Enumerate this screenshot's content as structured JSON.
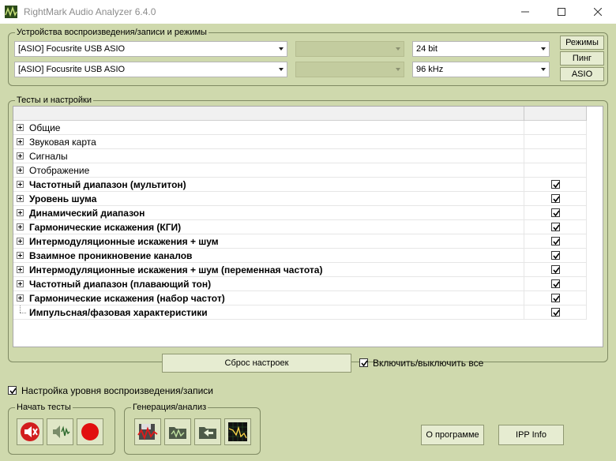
{
  "window": {
    "title": "RightMark Audio Analyzer 6.4.0"
  },
  "devices": {
    "label": "Устройства воспроизведения/записи и режимы",
    "playback_device": "[ASIO] Focusrite USB ASIO",
    "record_device": "[ASIO] Focusrite USB ASIO",
    "bit_depth": "24 bit",
    "sample_rate": "96 kHz",
    "modes_button": "Режимы",
    "ping_button": "Пинг",
    "asio_button": "ASIO"
  },
  "tests": {
    "label": "Тесты и настройки",
    "rows": [
      {
        "label": "Общие",
        "bold": false,
        "expandable": true,
        "checked": false,
        "has_checkbox": false
      },
      {
        "label": "Звуковая карта",
        "bold": false,
        "expandable": true,
        "checked": false,
        "has_checkbox": false
      },
      {
        "label": "Сигналы",
        "bold": false,
        "expandable": true,
        "checked": false,
        "has_checkbox": false
      },
      {
        "label": "Отображение",
        "bold": false,
        "expandable": true,
        "checked": false,
        "has_checkbox": false
      },
      {
        "label": "Частотный диапазон (мультитон)",
        "bold": true,
        "expandable": true,
        "checked": true,
        "has_checkbox": true
      },
      {
        "label": "Уровень шума",
        "bold": true,
        "expandable": true,
        "checked": true,
        "has_checkbox": true
      },
      {
        "label": "Динамический диапазон",
        "bold": true,
        "expandable": true,
        "checked": true,
        "has_checkbox": true
      },
      {
        "label": "Гармонические искажения (КГИ)",
        "bold": true,
        "expandable": true,
        "checked": true,
        "has_checkbox": true
      },
      {
        "label": "Интермодуляционные искажения + шум",
        "bold": true,
        "expandable": true,
        "checked": true,
        "has_checkbox": true
      },
      {
        "label": "Взаимное проникновение каналов",
        "bold": true,
        "expandable": true,
        "checked": true,
        "has_checkbox": true
      },
      {
        "label": "Интермодуляционные искажения + шум (переменная частота)",
        "bold": true,
        "expandable": true,
        "checked": true,
        "has_checkbox": true
      },
      {
        "label": "Частотный диапазон (плавающий тон)",
        "bold": true,
        "expandable": true,
        "checked": true,
        "has_checkbox": true
      },
      {
        "label": "Гармонические искажения (набор частот)",
        "bold": true,
        "expandable": true,
        "checked": true,
        "has_checkbox": true
      },
      {
        "label": "Импульсная/фазовая характеристики",
        "bold": true,
        "expandable": false,
        "checked": true,
        "has_checkbox": true
      }
    ],
    "reset_button": "Сброс настроек",
    "toggle_all_label": "Включить/выключить все"
  },
  "level_setup_label": "Настройка уровня воспроизведения/записи",
  "start_tests": {
    "label": "Начать тесты"
  },
  "generation": {
    "label": "Генерация/анализ"
  },
  "about_button": "О программе",
  "ipp_button": "IPP Info"
}
